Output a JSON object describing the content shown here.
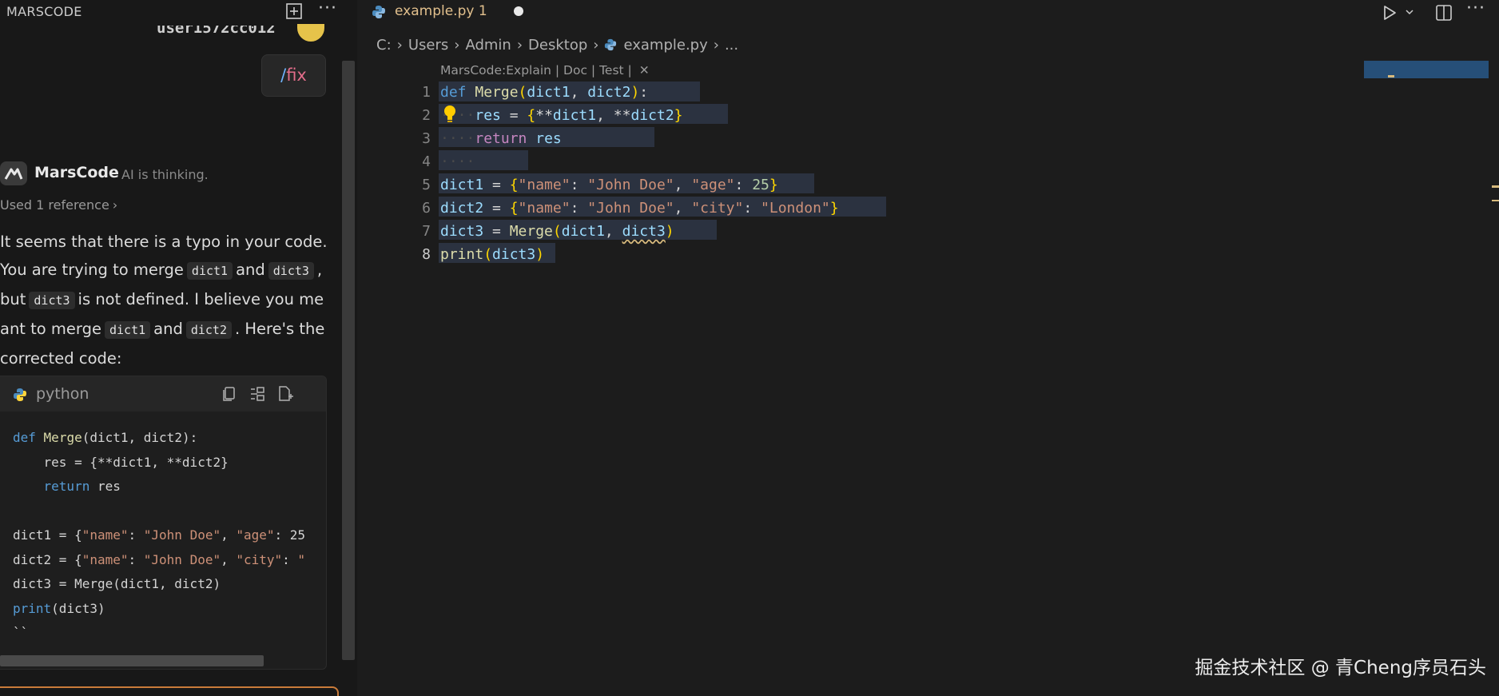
{
  "side": {
    "title": "MARSCODE",
    "user_partial": "user1572cc012",
    "fix_slash": "/",
    "fix_word": "fix",
    "assistant_name": "MarsCode",
    "assistant_status": "AI is thinking.",
    "reference": "Used 1 reference",
    "reply_parts": [
      "It seems that there is a typo in your code. You are trying to merge",
      "dict1",
      "and",
      "dict3",
      ", but",
      "dict3",
      "is not defined. I believe you meant to merge",
      "dict1",
      "and",
      "dict2",
      ". Here's the corrected code:"
    ],
    "code_lang": "python",
    "code_lines": [
      "def Merge(dict1, dict2):",
      "    res = {**dict1, **dict2}",
      "    return res",
      "",
      "dict1 = {\"name\": \"John Doe\", \"age\": 25",
      "dict2 = {\"name\": \"John Doe\", \"city\": \"",
      "dict3 = Merge(dict1, dict2)",
      "print(dict3)",
      "``"
    ]
  },
  "editor": {
    "tab_name": "example.py 1",
    "breadcrumb": [
      "C:",
      "Users",
      "Admin",
      "Desktop",
      "example.py",
      "..."
    ],
    "codelens": [
      "MarsCode:Explain",
      "Doc",
      "Test"
    ],
    "line_numbers": [
      "1",
      "2",
      "3",
      "4",
      "5",
      "6",
      "7",
      "8"
    ],
    "active_line": "8"
  },
  "watermark": "掘金技术社区 @ 青Cheng序员石头",
  "colors": {
    "accent_tab": "#e2c08d",
    "selection": "#2b3240",
    "minimap": "#264f78",
    "avatar": "#e6c34a"
  },
  "icons": [
    "new-chat-icon",
    "more-icon",
    "python-icon",
    "copy-icon",
    "insert-icon",
    "new-file-icon",
    "run-icon",
    "split-editor-icon",
    "lightbulb-icon",
    "marscode-logo-icon"
  ]
}
